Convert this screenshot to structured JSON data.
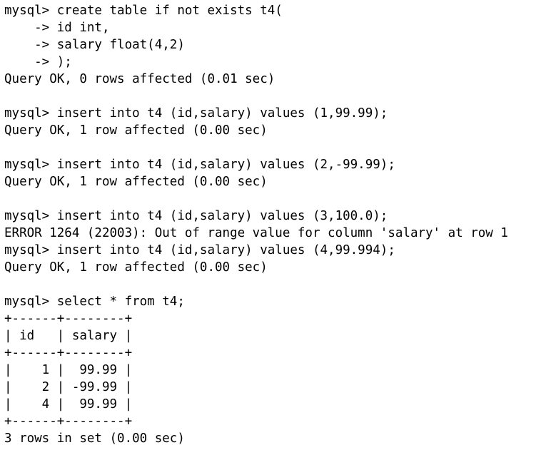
{
  "terminal": {
    "lines": [
      "mysql> create table if not exists t4(",
      "    -> id int,",
      "    -> salary float(4,2)",
      "    -> );",
      "Query OK, 0 rows affected (0.01 sec)",
      "",
      "mysql> insert into t4 (id,salary) values (1,99.99);",
      "Query OK, 1 row affected (0.00 sec)",
      "",
      "mysql> insert into t4 (id,salary) values (2,-99.99);",
      "Query OK, 1 row affected (0.00 sec)",
      "",
      "mysql> insert into t4 (id,salary) values (3,100.0);",
      "ERROR 1264 (22003): Out of range value for column 'salary' at row 1",
      "mysql> insert into t4 (id,salary) values (4,99.994);",
      "Query OK, 1 row affected (0.00 sec)",
      "",
      "mysql> select * from t4;",
      "+------+--------+",
      "| id   | salary |",
      "+------+--------+",
      "|    1 |  99.99 |",
      "|    2 | -99.99 |",
      "|    4 |  99.99 |",
      "+------+--------+",
      "3 rows in set (0.00 sec)"
    ]
  }
}
